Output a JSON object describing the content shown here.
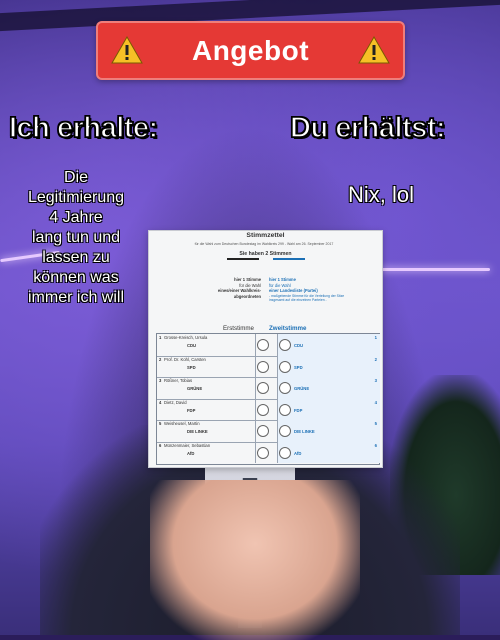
{
  "banner": {
    "title": "Angebot",
    "icon": "warning-icon"
  },
  "left": {
    "heading": "Ich erhalte:",
    "text_lines": [
      "Die",
      "Legitimierung",
      "4 Jahre",
      "lang tun und",
      "lassen zu",
      "können was",
      "immer ich will"
    ]
  },
  "right": {
    "heading": "Du erhältst:",
    "text": "Nix, lol"
  },
  "ballot": {
    "title": "Stimmzettel",
    "subtitle": "für die Wahl zum Deutschen Bundestag im Wahlkreis 299 - Wahl am 26. September 2017",
    "votes": "Sie haben 2 Stimmen",
    "first_vote_lines": [
      "hier 1 Stimme",
      "für die Wahl",
      "eines/einer Wahlkreis-",
      "abgeordneten"
    ],
    "second_vote_lines": [
      "hier 1 Stimme",
      "für die Wahl",
      "einer Landesliste (Partei)",
      "- maßgebende Stimme für die Verteilung der Sitze",
      "insgesamt auf die einzelnen Parteien -"
    ],
    "erststimme": "Erststimme",
    "zweitstimme": "Zweitstimme",
    "rows": [
      {
        "num": "1",
        "name": "Grosse-Kreisch, Ursula",
        "party": "CDU",
        "zparty": "CDU"
      },
      {
        "num": "2",
        "name": "Prof. Dr. Kohl, Carsten",
        "party": "SPD",
        "zparty": "SPD"
      },
      {
        "num": "3",
        "name": "Rößner, Tobias",
        "party": "GRÜNE",
        "zparty": "GRÜNE"
      },
      {
        "num": "4",
        "name": "Dietz, David",
        "party": "FDP",
        "zparty": "FDP"
      },
      {
        "num": "5",
        "name": "Weisheusel, Martin",
        "party": "DIE LINKE",
        "zparty": "DIE LINKE"
      },
      {
        "num": "6",
        "name": "Münzenmaier, Sebastian",
        "party": "AfD",
        "zparty": "AfD"
      }
    ]
  },
  "colors": {
    "banner": "#e53935",
    "heading_text": "#ffffff",
    "ballot_blue": "#1b6fb5"
  }
}
